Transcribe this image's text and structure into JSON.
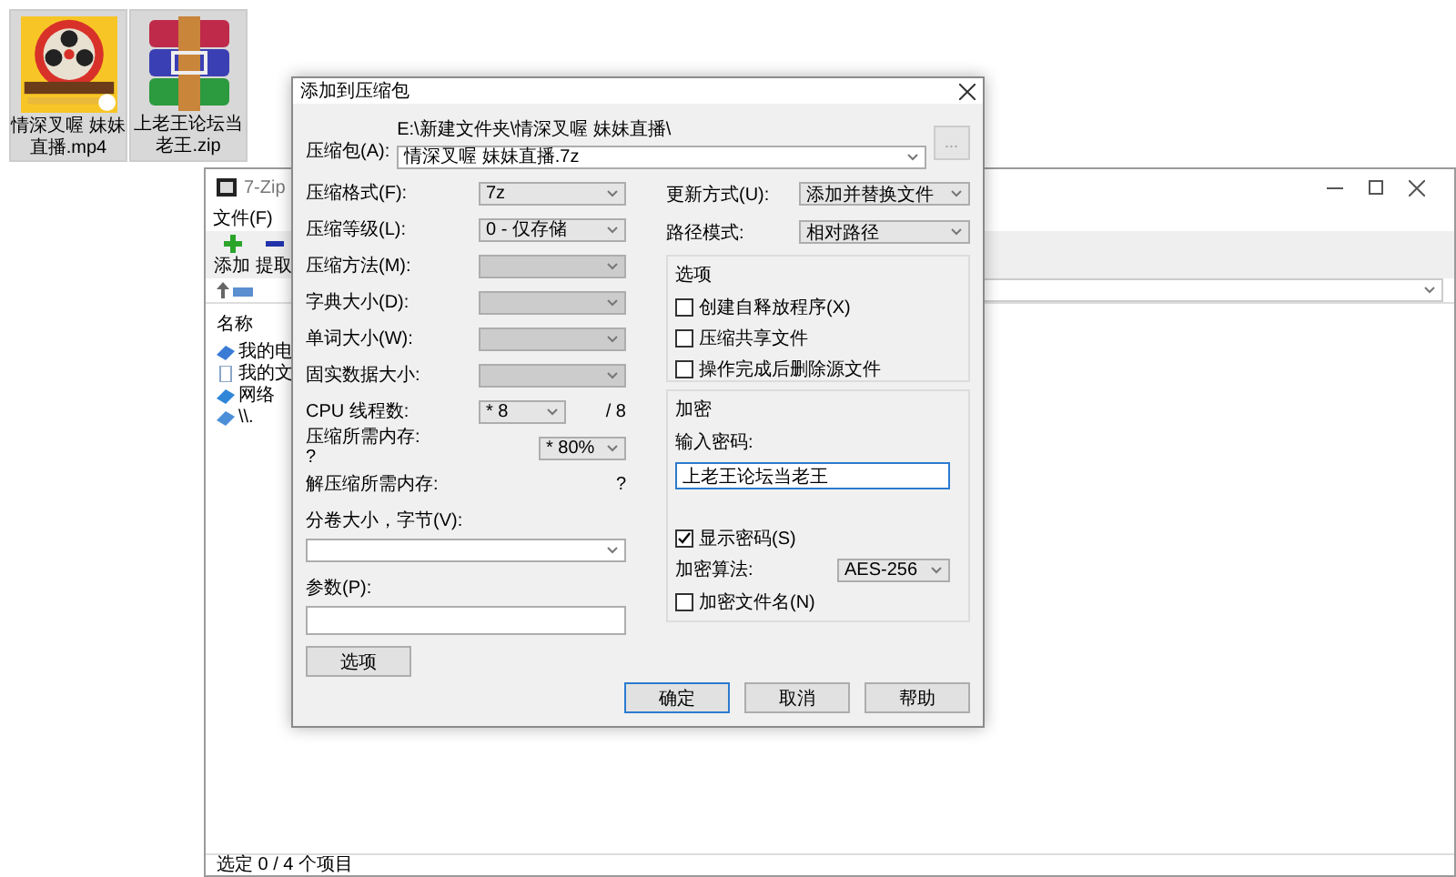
{
  "desktop_icons": [
    {
      "label": "情深叉喔 妹妹直播.mp4",
      "kind": "video",
      "selected": true
    },
    {
      "label": "上老王论坛当老王.zip",
      "kind": "archive",
      "selected": true
    }
  ],
  "sevenzip_window": {
    "title": "7-Zip",
    "menu": [
      "文件(F)"
    ],
    "toolbar": [
      {
        "label": "添加",
        "kind": "add"
      },
      {
        "label": "提取",
        "kind": "extract"
      }
    ],
    "list_header": "名称",
    "items": [
      {
        "label": "我的电",
        "kind": "computer"
      },
      {
        "label": "我的文",
        "kind": "documents"
      },
      {
        "label": "网络",
        "kind": "network"
      },
      {
        "label": "\\\\.",
        "kind": "share"
      }
    ],
    "status": "选定 0 / 4 个项目"
  },
  "dialog": {
    "title": "添加到压缩包",
    "archive_label": "压缩包(A):",
    "archive_path": "E:\\新建文件夹\\情深叉喔 妹妹直播\\",
    "archive_name": "情深叉喔 妹妹直播.7z",
    "browse": "...",
    "left_fields": [
      {
        "kind": "select",
        "label": "压缩格式(F):",
        "value": "7z",
        "disabled": false
      },
      {
        "kind": "select",
        "label": "压缩等级(L):",
        "value": "0 - 仅存储",
        "disabled": false
      },
      {
        "kind": "select",
        "label": "压缩方法(M):",
        "disabled": true
      },
      {
        "kind": "select",
        "label": "字典大小(D):",
        "disabled": true
      },
      {
        "kind": "select",
        "label": "单词大小(W):",
        "disabled": true
      },
      {
        "kind": "select",
        "label": "固实数据大小:",
        "disabled": true
      },
      {
        "kind": "short",
        "label": "CPU 线程数:",
        "value": "* 8",
        "suffix": "/ 8"
      },
      {
        "kind": "memory",
        "label": "压缩所需内存:",
        "sublabel": "?",
        "value": "* 80%"
      },
      {
        "kind": "info",
        "label": "解压缩所需内存:",
        "reading": "?"
      }
    ],
    "volume_label": "分卷大小，字节(V):",
    "params_label": "参数(P):",
    "options_button": "选项",
    "right_fields": [
      {
        "label": "更新方式(U):",
        "value": "添加并替换文件"
      },
      {
        "label": "路径模式:",
        "value": "相对路径"
      }
    ],
    "options_group": {
      "title": "选项",
      "checkboxes": [
        {
          "label": "创建自释放程序(X)",
          "checked": false
        },
        {
          "label": "压缩共享文件",
          "checked": false
        },
        {
          "label": "操作完成后删除源文件",
          "checked": false
        }
      ]
    },
    "encryption": {
      "title": "加密",
      "password_label": "输入密码:",
      "password": "上老王论坛当老王",
      "show_password": {
        "label": "显示密码(S)",
        "checked": true
      },
      "method_label": "加密算法:",
      "method": "AES-256",
      "encrypt_names": {
        "label": "加密文件名(N)",
        "checked": false
      }
    },
    "buttons": [
      {
        "label": "确定",
        "default": true
      },
      {
        "label": "取消",
        "default": false
      },
      {
        "label": "帮助",
        "default": false
      }
    ]
  }
}
